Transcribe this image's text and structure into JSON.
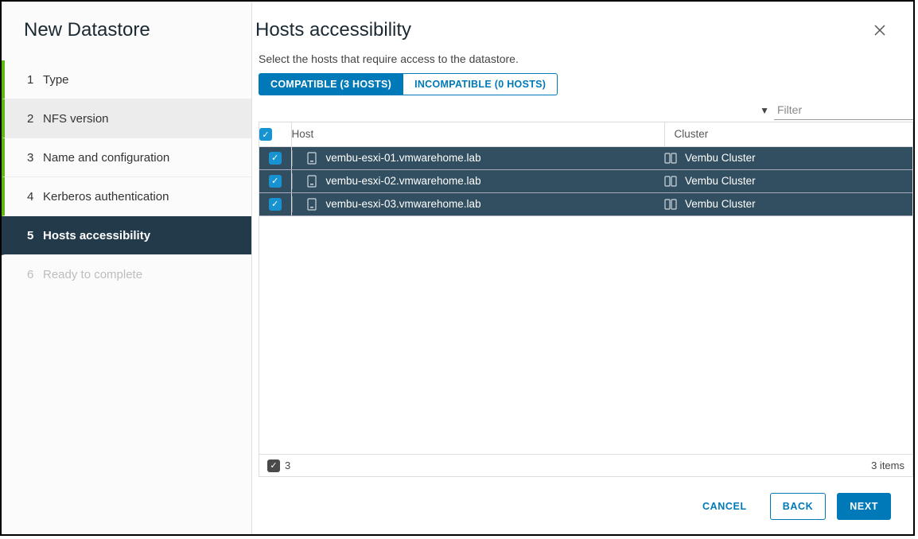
{
  "wizard_title": "New Datastore",
  "steps": [
    {
      "num": "1",
      "label": "Type"
    },
    {
      "num": "2",
      "label": "NFS version"
    },
    {
      "num": "3",
      "label": "Name and configuration"
    },
    {
      "num": "4",
      "label": "Kerberos authentication"
    },
    {
      "num": "5",
      "label": "Hosts accessibility"
    },
    {
      "num": "6",
      "label": "Ready to complete"
    }
  ],
  "page": {
    "title": "Hosts accessibility",
    "subtitle": "Select the hosts that require access to the datastore."
  },
  "tabs": {
    "compatible": "COMPATIBLE (3 HOSTS)",
    "incompatible": "INCOMPATIBLE (0 HOSTS)"
  },
  "filter": {
    "placeholder": "Filter"
  },
  "columns": {
    "host": "Host",
    "cluster": "Cluster"
  },
  "rows": [
    {
      "host": "vembu-esxi-01.vmwarehome.lab",
      "cluster": "Vembu Cluster"
    },
    {
      "host": "vembu-esxi-02.vmwarehome.lab",
      "cluster": "Vembu Cluster"
    },
    {
      "host": "vembu-esxi-03.vmwarehome.lab",
      "cluster": "Vembu Cluster"
    }
  ],
  "footer_table": {
    "selected_count": "3",
    "total_items": "3 items"
  },
  "buttons": {
    "cancel": "CANCEL",
    "back": "BACK",
    "next": "NEXT"
  }
}
